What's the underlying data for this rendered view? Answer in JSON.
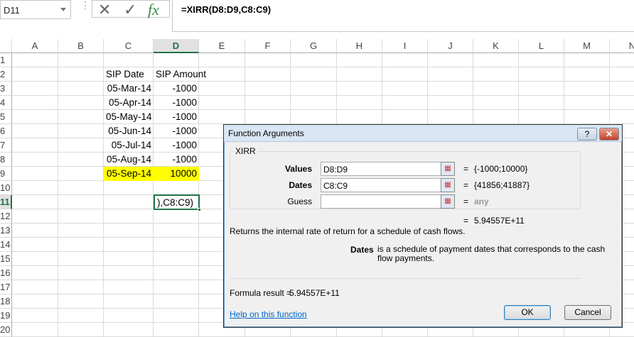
{
  "formula_bar": {
    "name_box": "D11",
    "formula": "=XIRR(D8:D9,C8:C9)",
    "cancel_icon": "✕",
    "enter_icon": "✓",
    "fx_icon": "fx"
  },
  "columns": [
    "A",
    "B",
    "C",
    "D",
    "E",
    "F",
    "G",
    "H",
    "I",
    "J",
    "K",
    "L",
    "M",
    "N"
  ],
  "selected_column": "D",
  "rows": [
    "1",
    "2",
    "3",
    "4",
    "5",
    "6",
    "7",
    "8",
    "9",
    "10",
    "11",
    "12",
    "13",
    "14",
    "15",
    "16",
    "17",
    "18",
    "19",
    "20"
  ],
  "selected_row": "11",
  "cells": {
    "headers": {
      "c": "SIP Date",
      "d": "SIP Amount"
    },
    "dates": [
      "05-Mar-14",
      "05-Apr-14",
      "05-May-14",
      "05-Jun-14",
      "05-Jul-14",
      "05-Aug-14",
      "05-Sep-14"
    ],
    "amounts": [
      "-1000",
      "-1000",
      "-1000",
      "-1000",
      "-1000",
      "-1000",
      "10000"
    ],
    "active_edit": "),C8:C9)",
    "highlight_color": "#ffff00"
  },
  "dialog": {
    "title": "Function Arguments",
    "help": "?",
    "close": "✕",
    "function_name": "XIRR",
    "args": [
      {
        "label": "Values",
        "value": "D8:D9",
        "result": "{-1000;10000}"
      },
      {
        "label": "Dates",
        "value": "C8:C9",
        "result": "{41856;41887}"
      },
      {
        "label": "Guess",
        "value": "",
        "result": "any"
      }
    ],
    "equals": "=",
    "overall_result": "5.94557E+11",
    "description": "Returns the internal rate of return for a schedule of cash flows.",
    "arg_help_name": "Dates",
    "arg_help_text": "is a schedule of payment dates that corresponds to the cash flow payments.",
    "formula_result_label": "Formula result =",
    "formula_result": "5.94557E+11",
    "help_link": "Help on this function",
    "ok": "OK",
    "cancel": "Cancel"
  }
}
